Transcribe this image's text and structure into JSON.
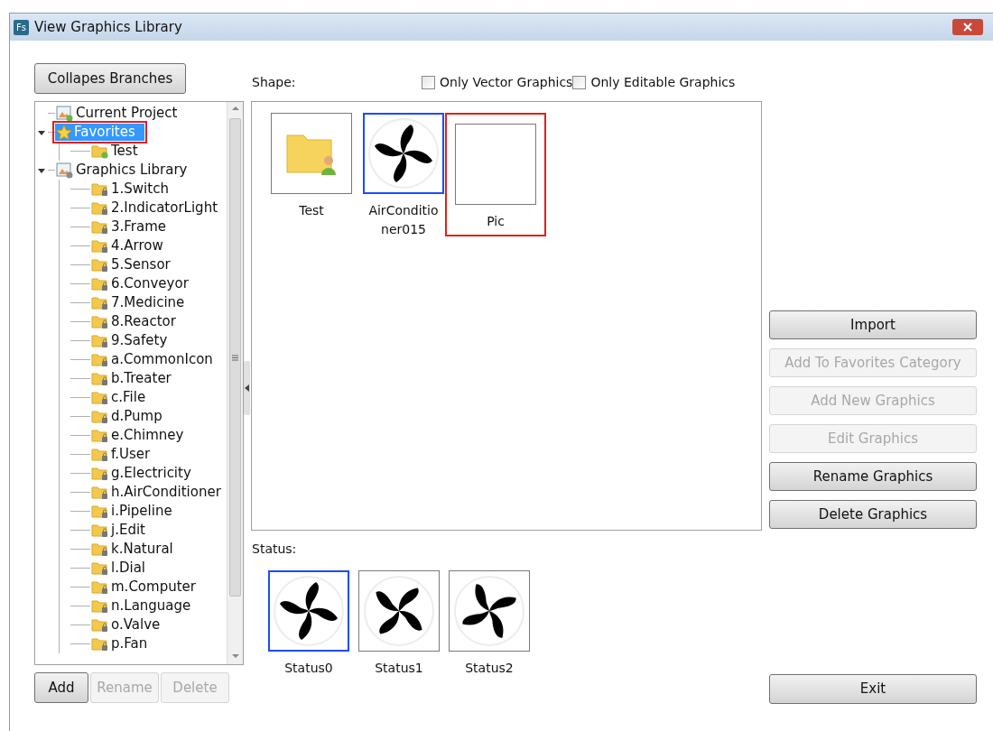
{
  "window": {
    "title": "View Graphics Library",
    "logo": "Fs"
  },
  "collapse_button": "Collapes Branches",
  "tree": [
    {
      "label": "Current Project",
      "kind": "project",
      "selected": false,
      "annotated": false
    },
    {
      "label": "Favorites",
      "kind": "star",
      "selected": true,
      "annotated": true,
      "expanded": true,
      "children": [
        {
          "label": "Test",
          "kind": "user-folder",
          "selected": false,
          "annotated": false
        }
      ]
    },
    {
      "label": "Graphics Library",
      "kind": "library",
      "selected": false,
      "annotated": false,
      "expanded": true,
      "children": [
        {
          "label": "1.Switch",
          "kind": "locked-folder",
          "selected": false,
          "annotated": false
        },
        {
          "label": "2.IndicatorLight",
          "kind": "locked-folder",
          "selected": false,
          "annotated": false
        },
        {
          "label": "3.Frame",
          "kind": "locked-folder",
          "selected": false,
          "annotated": false
        },
        {
          "label": "4.Arrow",
          "kind": "locked-folder",
          "selected": false,
          "annotated": false
        },
        {
          "label": "5.Sensor",
          "kind": "locked-folder",
          "selected": false,
          "annotated": false
        },
        {
          "label": "6.Conveyor",
          "kind": "locked-folder",
          "selected": false,
          "annotated": false
        },
        {
          "label": "7.Medicine",
          "kind": "locked-folder",
          "selected": false,
          "annotated": false
        },
        {
          "label": "8.Reactor",
          "kind": "locked-folder",
          "selected": false,
          "annotated": false
        },
        {
          "label": "9.Safety",
          "kind": "locked-folder",
          "selected": false,
          "annotated": false
        },
        {
          "label": "a.CommonIcon",
          "kind": "locked-folder",
          "selected": false,
          "annotated": false
        },
        {
          "label": "b.Treater",
          "kind": "locked-folder",
          "selected": false,
          "annotated": false
        },
        {
          "label": "c.File",
          "kind": "locked-folder",
          "selected": false,
          "annotated": false
        },
        {
          "label": "d.Pump",
          "kind": "locked-folder",
          "selected": false,
          "annotated": false
        },
        {
          "label": "e.Chimney",
          "kind": "locked-folder",
          "selected": false,
          "annotated": false
        },
        {
          "label": "f.User",
          "kind": "locked-folder",
          "selected": false,
          "annotated": false
        },
        {
          "label": "g.Electricity",
          "kind": "locked-folder",
          "selected": false,
          "annotated": false
        },
        {
          "label": "h.AirConditioner",
          "kind": "locked-folder",
          "selected": false,
          "annotated": false
        },
        {
          "label": "i.Pipeline",
          "kind": "locked-folder",
          "selected": false,
          "annotated": false
        },
        {
          "label": "j.Edit",
          "kind": "locked-folder",
          "selected": false,
          "annotated": false
        },
        {
          "label": "k.Natural",
          "kind": "locked-folder",
          "selected": false,
          "annotated": false
        },
        {
          "label": "l.Dial",
          "kind": "locked-folder",
          "selected": false,
          "annotated": false
        },
        {
          "label": "m.Computer",
          "kind": "locked-folder",
          "selected": false,
          "annotated": false
        },
        {
          "label": "n.Language",
          "kind": "locked-folder",
          "selected": false,
          "annotated": false
        },
        {
          "label": "o.Valve",
          "kind": "locked-folder",
          "selected": false,
          "annotated": false
        },
        {
          "label": "p.Fan",
          "kind": "locked-folder",
          "selected": false,
          "annotated": false
        }
      ]
    }
  ],
  "tree_buttons": [
    {
      "label": "Add",
      "disabled": false
    },
    {
      "label": "Rename",
      "disabled": true
    },
    {
      "label": "Delete",
      "disabled": true
    }
  ],
  "shape_label": "Shape:",
  "filters": [
    {
      "label": "Only Vector Graphics",
      "checked": false
    },
    {
      "label": "Only Editable Graphics",
      "checked": false
    }
  ],
  "shapes": [
    {
      "label": "Test",
      "kind": "folder",
      "selected": false,
      "annotated": false
    },
    {
      "label": "AirConditioner015",
      "kind": "fan",
      "selected": true,
      "annotated": false
    },
    {
      "label": "Pic",
      "kind": "blank",
      "selected": false,
      "annotated": true
    }
  ],
  "status_label": "Status:",
  "statuses": [
    {
      "label": "Status0",
      "selected": true
    },
    {
      "label": "Status1",
      "selected": false
    },
    {
      "label": "Status2",
      "selected": false
    }
  ],
  "actions": [
    {
      "label": "Import",
      "disabled": false
    },
    {
      "label": "Add To Favorites Category",
      "disabled": true
    },
    {
      "label": "Add New Graphics",
      "disabled": true
    },
    {
      "label": "Edit Graphics",
      "disabled": true
    },
    {
      "label": "Rename Graphics",
      "disabled": false
    },
    {
      "label": "Delete Graphics",
      "disabled": false
    }
  ],
  "exit_button": "Exit"
}
